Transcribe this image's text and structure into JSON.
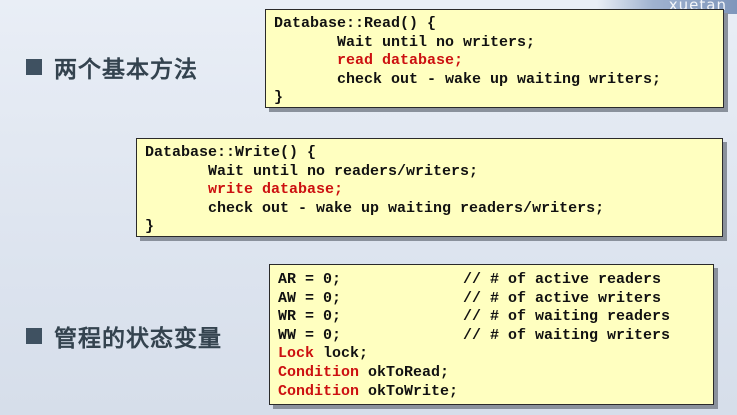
{
  "colors": {
    "background": "#e2e8f2",
    "box_fill": "#ffffc0",
    "keyword_red": "#cc1010",
    "bullet": "#3f5161"
  },
  "corner_logo": "xuetan",
  "bullets": [
    {
      "text": "两个基本方法"
    },
    {
      "text": "管程的状态变量"
    }
  ],
  "read_box": {
    "lines": [
      {
        "text": "Database::Read() {",
        "red": false
      },
      {
        "text": "       Wait until no writers;",
        "red": false
      },
      {
        "text": "       read database;",
        "red": true
      },
      {
        "text": "       check out - wake up waiting writers;",
        "red": false
      },
      {
        "text": "}",
        "red": false
      }
    ]
  },
  "write_box": {
    "lines": [
      {
        "text": "Database::Write() {",
        "red": false
      },
      {
        "text": "       Wait until no readers/writers;",
        "red": false
      },
      {
        "text": "       write database;",
        "red": true
      },
      {
        "text": "       check out - wake up waiting readers/writers;",
        "red": false
      },
      {
        "text": "}",
        "red": false
      }
    ]
  },
  "state_box": {
    "vars": [
      {
        "decl": "AR = 0;",
        "comment": "// # of active readers"
      },
      {
        "decl": "AW = 0;",
        "comment": "// # of active writers"
      },
      {
        "decl": "WR = 0;",
        "comment": "// # of waiting readers"
      },
      {
        "decl": "WW = 0;",
        "comment": "// # of waiting writers"
      }
    ],
    "objects": [
      {
        "type": "Lock",
        "name": " lock;"
      },
      {
        "type": "Condition",
        "name": " okToRead;"
      },
      {
        "type": "Condition",
        "name": " okToWrite;"
      }
    ]
  }
}
